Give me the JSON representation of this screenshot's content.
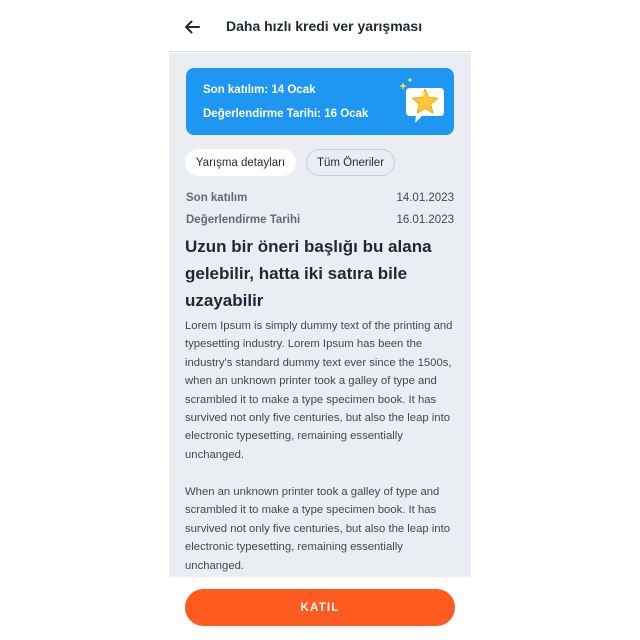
{
  "header": {
    "title": "Daha hızlı kredi ver yarışması",
    "back_icon": "arrow-left-icon"
  },
  "banner": {
    "line1": "Son katılım: 14 Ocak",
    "line2": "Değerlendirme Tarihi: 16 Ocak",
    "icon": "star-sticker-icon",
    "color": "#1e97f3"
  },
  "tabs": [
    {
      "label": "Yarışma detayları",
      "active": true
    },
    {
      "label": "Tüm Öneriler",
      "active": false
    }
  ],
  "details": {
    "deadline_label": "Son katılım",
    "deadline_value": "14.01.2023",
    "evaluation_label": "Değerlendirme Tarihi",
    "evaluation_value": "16.01.2023"
  },
  "article": {
    "title": "Uzun bir öneri başlığı bu alana gelebilir, hatta iki satıra bile uzayabilir",
    "paragraph1": "Lorem Ipsum is simply dummy text of the printing and typesetting industry. Lorem Ipsum has been the industry's standard dummy text ever since the 1500s, when an unknown printer took a galley of type and scrambled it to make a type specimen book. It has survived not only five centuries, but also the leap into electronic typesetting, remaining essentially unchanged.",
    "paragraph2": "When an unknown printer took a galley of type and scrambled it to make a type specimen book. It has survived not only five centuries, but also the leap into electronic typesetting, remaining essentially unchanged."
  },
  "footer": {
    "join_label": "KATIL",
    "accent": "#ff5a1f"
  }
}
